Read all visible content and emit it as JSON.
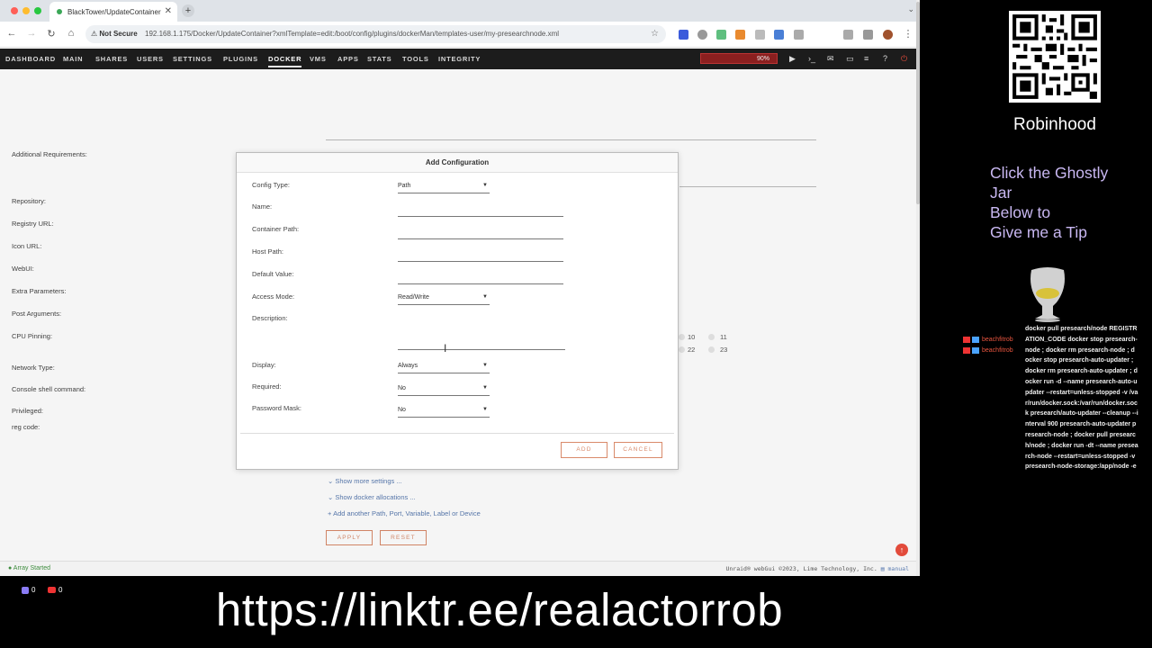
{
  "browser": {
    "tab_title": "BlackTower/UpdateContainer",
    "not_secure": "Not Secure",
    "url": "192.168.1.175/Docker/UpdateContainer?xmlTemplate=edit:/boot/config/plugins/dockerMan/templates-user/my-presearchnode.xml"
  },
  "nav": {
    "items": [
      "DASHBOARD",
      "MAIN",
      "SHARES",
      "USERS",
      "SETTINGS",
      "PLUGINS",
      "DOCKER",
      "VMS",
      "APPS",
      "STATS",
      "TOOLS",
      "INTEGRITY"
    ],
    "active": "DOCKER",
    "cpu_label": "90%"
  },
  "page": {
    "labels": {
      "additional_requirements": "Additional Requirements:",
      "repository": "Repository:",
      "registry_url": "Registry URL:",
      "icon_url": "Icon URL:",
      "webui": "WebUI:",
      "extra_parameters": "Extra Parameters:",
      "post_arguments": "Post Arguments:",
      "cpu_pinning": "CPU Pinning:",
      "network_type": "Network Type:",
      "console_shell": "Console shell command:",
      "privileged": "Privileged:",
      "reg_code": "reg code:"
    },
    "cpu_cores": [
      "10",
      "11",
      "22",
      "23"
    ],
    "show_more_settings": "Show more settings ...",
    "show_docker_allocations": "Show docker allocations ...",
    "add_another": "Add another Path, Port, Variable, Label or Device",
    "apply": "APPLY",
    "reset": "RESET"
  },
  "modal": {
    "title": "Add Configuration",
    "fields": {
      "config_type": {
        "label": "Config Type:",
        "value": "Path"
      },
      "name": {
        "label": "Name:"
      },
      "container_path": {
        "label": "Container Path:"
      },
      "host_path": {
        "label": "Host Path:"
      },
      "default_value": {
        "label": "Default Value:"
      },
      "access_mode": {
        "label": "Access Mode:",
        "value": "Read/Write"
      },
      "description": {
        "label": "Description:"
      },
      "display": {
        "label": "Display:",
        "value": "Always"
      },
      "required": {
        "label": "Required:",
        "value": "No"
      },
      "password_mask": {
        "label": "Password Mask:",
        "value": "No"
      }
    },
    "add": "ADD",
    "cancel": "CANCEL"
  },
  "status": {
    "array": "Array Started",
    "copyright": "Unraid® webGui ©2023, Lime Technology, Inc.",
    "manual": "manual"
  },
  "overlay": {
    "robinhood": "Robinhood",
    "tip_lines": [
      "Click the Ghostly",
      "Jar",
      "Below to",
      "Give me a Tip"
    ],
    "chat_user": "beachfitrob",
    "chat_text": "docker pull presearch/node REGISTRATION_CODE docker stop presearch-node ; docker rm presearch-node ; docker stop presearch-auto-updater ; docker rm presearch-auto-updater ; docker run -d --name presearch-auto-updater --restart=unless-stopped -v /var/run/docker.sock:/var/run/docker.sock presearch/auto-updater --cleanup --interval 900 presearch-auto-updater presearch-node ; docker pull presearch/node ; docker run -dt --name presearch-node --restart=unless-stopped -v presearch-node-storage:/app/node -e",
    "count1": "0",
    "count2": "0",
    "linktree": "https://linktr.ee/realactorrob"
  },
  "colors": {
    "accent": "#d98a6a",
    "nav_bg": "#1c1c1c",
    "link": "#5a7bb0",
    "tip": "#c9b8f2"
  }
}
